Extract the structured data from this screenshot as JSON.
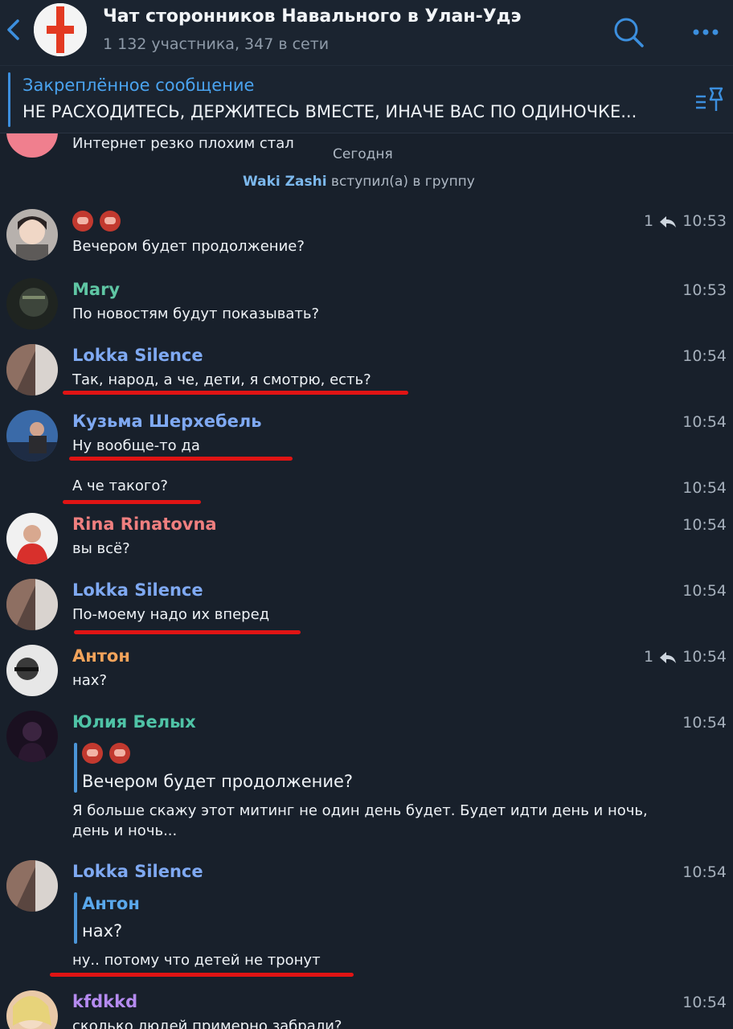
{
  "header": {
    "title": "Чат сторонников Навального в Улан-Удэ",
    "subtitle": "1 132 участника, 347 в сети",
    "back_icon": "chevron-left-icon",
    "search_icon": "search-icon",
    "more_icon": "more-icon"
  },
  "pinned": {
    "title": "Закреплённое сообщение",
    "text": "НЕ РАСХОДИТЕСЬ, ДЕРЖИТЕСЬ ВМЕСТЕ, ИНАЧЕ ВАС ПО ОДИНОЧКЕ..."
  },
  "chat": {
    "previous_text": "Интернет резко плохим стал",
    "date_separator": "Сегодня",
    "join_name": "Waki Zashi",
    "join_text": "вступил(а) в группу",
    "messages": [
      {
        "name": "",
        "text": "Вечером будет продолжение?",
        "time": "10:53",
        "replies": "1"
      },
      {
        "name": "Mary",
        "text": "По новостям будут показывать?",
        "time": "10:53"
      },
      {
        "name": "Lokka Silence",
        "text": "Так, народ, а че, дети, я смотрю, есть?",
        "time": "10:54"
      },
      {
        "name": "Кузьма Шерхебель",
        "text": "Ну вообще-то да",
        "time": "10:54"
      },
      {
        "name": "",
        "text": "А че такого?",
        "time": "10:54"
      },
      {
        "name": "Rina Rinatovna",
        "text": "вы всё?",
        "time": "10:54"
      },
      {
        "name": "Lokka Silence",
        "text": "По-моему надо их вперед",
        "time": "10:54"
      },
      {
        "name": "Антон",
        "text": "нах?",
        "time": "10:54",
        "replies": "1"
      },
      {
        "name": "Юлия Белых",
        "quote_text": "Вечером будет продолжение?",
        "text": "Я больше скажу этот митинг не один день будет. Будет идти день и ночь, день и ночь...",
        "time": "10:54"
      },
      {
        "name": "Lokka Silence",
        "quote_name": "Антон",
        "quote_text": "нах?",
        "text": "ну.. потому что детей не тронут",
        "time": "10:54"
      },
      {
        "name": "kfdkkd",
        "text": "сколько людей примерно забрали?",
        "time": "10:54"
      }
    ]
  },
  "colors": {
    "background": "#18202b",
    "accent": "#4aa3ef",
    "underline": "#e01414",
    "name_mary": "#5fc6a4",
    "name_lokka": "#7fa9f2",
    "name_rina": "#ef7f7f",
    "name_anton": "#f2a35b",
    "name_yulia": "#4fc3a6",
    "name_kfdkkd": "#b58bf0"
  }
}
